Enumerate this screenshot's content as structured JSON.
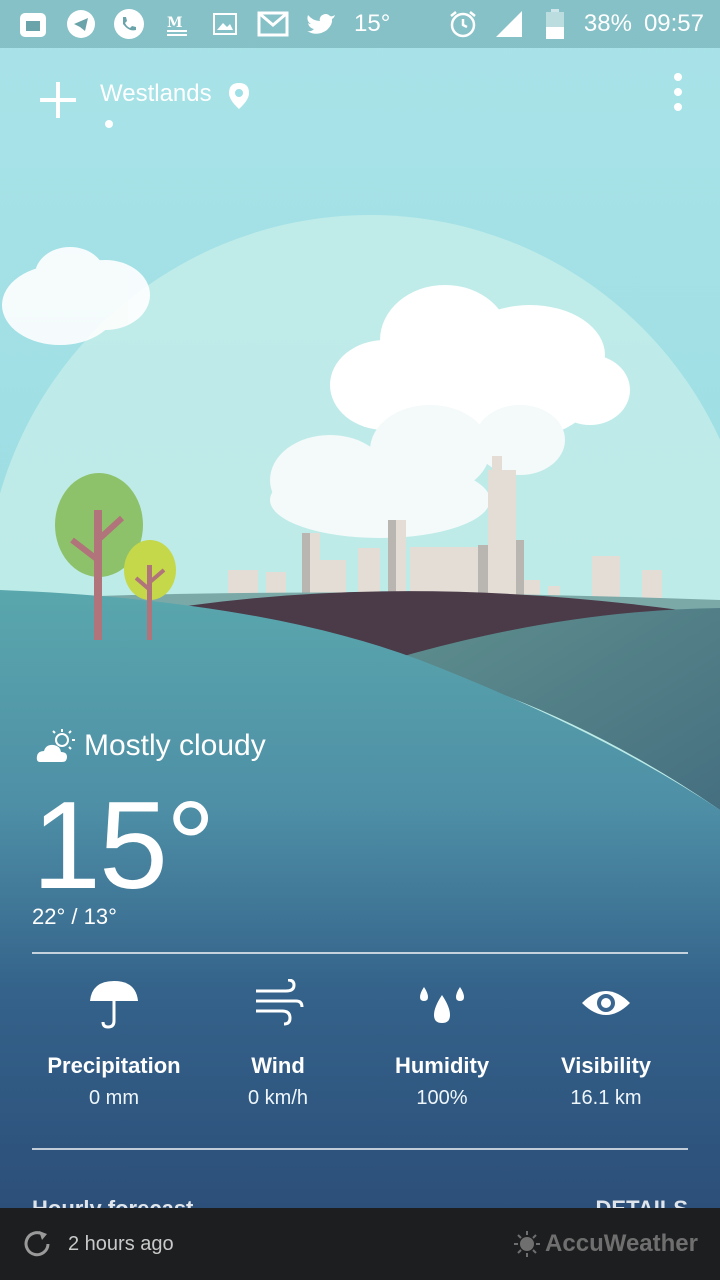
{
  "status_bar": {
    "notification_temp": "15°",
    "battery": "38%",
    "time": "09:57",
    "icons": [
      "calendar-icon",
      "telegram-icon",
      "phone-icon",
      "medium-icon",
      "gallery-icon",
      "gmail-icon",
      "twitter-icon"
    ]
  },
  "header": {
    "location": "Westlands"
  },
  "current": {
    "condition": "Mostly cloudy",
    "temperature": "15°",
    "high_low": "22° / 13°"
  },
  "stats": [
    {
      "label": "Precipitation",
      "value": "0 mm",
      "icon": "umbrella-icon"
    },
    {
      "label": "Wind",
      "value": "0 km/h",
      "icon": "wind-icon"
    },
    {
      "label": "Humidity",
      "value": "100%",
      "icon": "humidity-icon"
    },
    {
      "label": "Visibility",
      "value": "16.1 km",
      "icon": "eye-icon"
    }
  ],
  "hourly": {
    "title": "Hourly forecast",
    "details_label": "DETAILS"
  },
  "footer": {
    "updated": "2 hours ago",
    "brand": "AccuWeather"
  },
  "colors": {
    "sky": "#9fdfe6",
    "hill_dark": "#4b3a48",
    "ground_blue": "#2f5a86",
    "footer_bg": "#1d1e1f"
  }
}
